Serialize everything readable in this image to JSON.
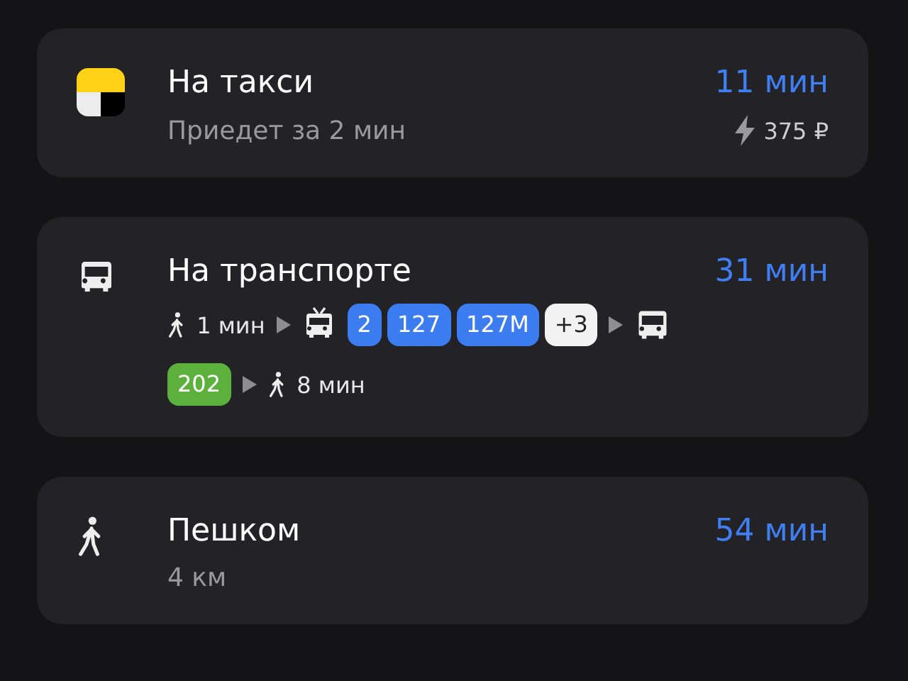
{
  "options": [
    {
      "kind": "taxi",
      "title": "На такси",
      "subtitle": "Приедет за 2 мин",
      "time": "11 мин",
      "price": "375 ₽"
    },
    {
      "kind": "transit",
      "title": "На транспорте",
      "time": "31 мин",
      "legs": [
        {
          "kind": "walk",
          "text": "1 мин"
        },
        {
          "kind": "arrow"
        },
        {
          "kind": "trolleybus",
          "routes": [
            {
              "label": "2",
              "color": "#3b7cf0"
            },
            {
              "label": "127",
              "color": "#3b7cf0"
            },
            {
              "label": "127М",
              "color": "#3b7cf0"
            },
            {
              "label": "+3",
              "color": "#f2f2f2"
            }
          ]
        },
        {
          "kind": "arrow"
        },
        {
          "kind": "bus",
          "routes": [
            {
              "label": "202",
              "color": "#5bb13c"
            }
          ]
        },
        {
          "kind": "arrow"
        },
        {
          "kind": "walk",
          "text": "8 мин"
        }
      ]
    },
    {
      "kind": "walk",
      "title": "Пешком",
      "subtitle": "4 км",
      "time": "54 мин"
    }
  ]
}
